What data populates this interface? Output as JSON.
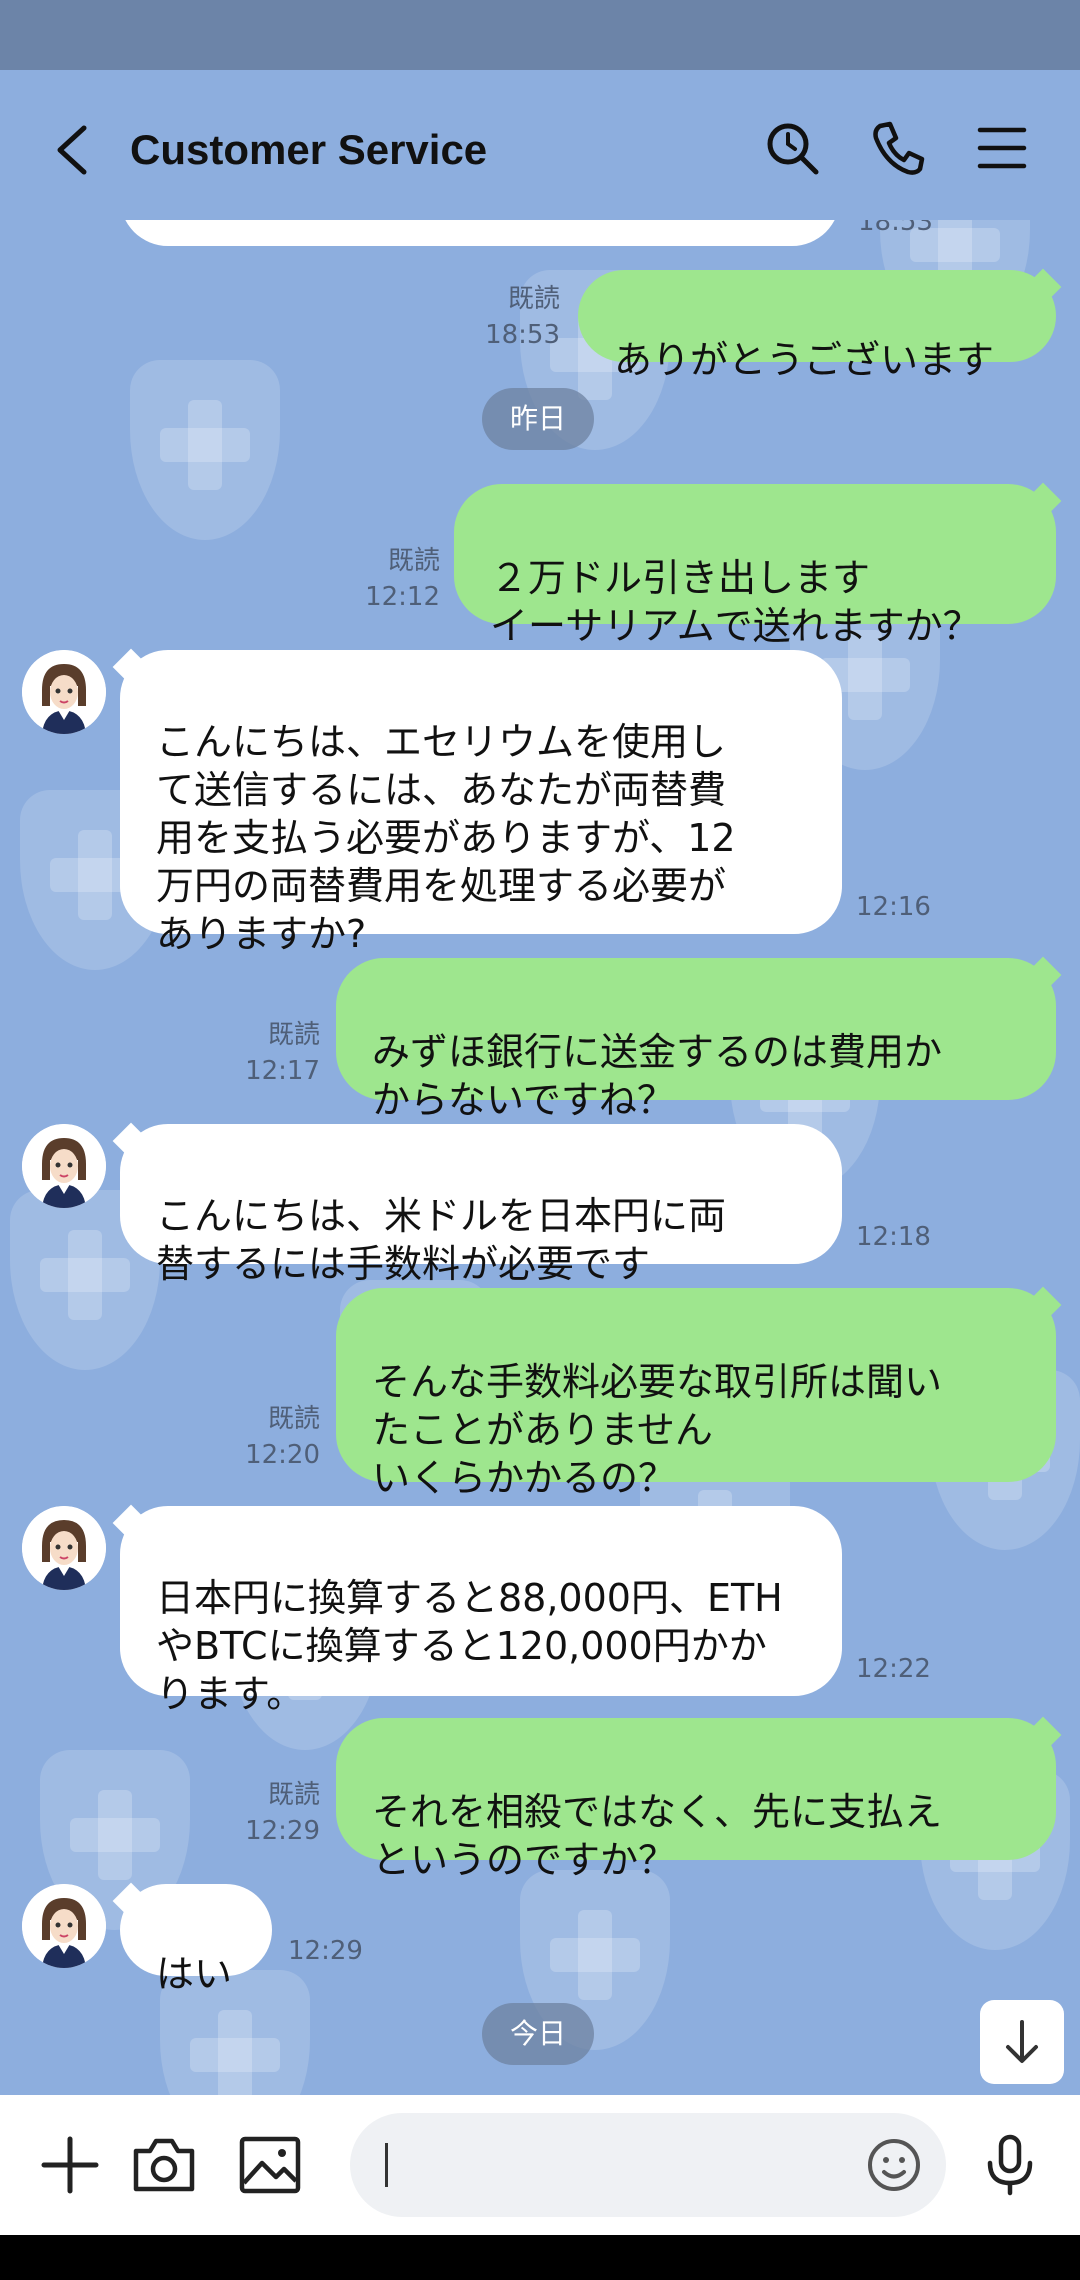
{
  "header": {
    "title": "Customer Service"
  },
  "messages": [
    {
      "side": "out",
      "text": "ありがとうございます",
      "read": "既読",
      "time": "18:53"
    },
    {
      "side": "date",
      "text": "昨日"
    },
    {
      "side": "out",
      "text": "２万ドル引き出します\nイーサリアムで送れますか？",
      "read": "既読",
      "time": "12:12"
    },
    {
      "side": "in",
      "text": "こんにちは、エセリウムを使用し\nて送信するには、あなたが両替費\n用を支払う必要がありますが、12\n万円の両替費用を処理する必要が\nありますか?",
      "time": "12:16"
    },
    {
      "side": "out",
      "text": "みずほ銀行に送金するのは費用か\nからないですね？",
      "read": "既読",
      "time": "12:17"
    },
    {
      "side": "in",
      "text": "こんにちは、米ドルを日本円に両\n替するには手数料が必要です",
      "time": "12:18"
    },
    {
      "side": "out",
      "text": "そんな手数料必要な取引所は聞い\nたことがありません\nいくらかかるの？",
      "read": "既読",
      "time": "12:20"
    },
    {
      "side": "in",
      "text": "日本円に換算すると88,000円、ETH\nやBTCに換算すると120,000円かか\nります。",
      "time": "12:22"
    },
    {
      "side": "out",
      "text": "それを相殺ではなく、先に支払え\nというのですか？",
      "read": "既読",
      "time": "12:29"
    },
    {
      "side": "in",
      "text": "はい",
      "time": "12:29"
    },
    {
      "side": "date",
      "text": "今日"
    }
  ],
  "partial_top": {
    "time": "18:53"
  },
  "input": {
    "placeholder": "",
    "value": ""
  },
  "icons": {
    "back": "chevron-left-icon",
    "search": "search-icon",
    "call": "phone-icon",
    "menu": "hamburger-menu-icon",
    "plus": "plus-icon",
    "camera": "camera-icon",
    "image": "image-icon",
    "emoji": "emoji-icon",
    "mic": "microphone-icon",
    "scroll": "arrow-down-icon"
  },
  "colors": {
    "background": "#8DAEDE",
    "outgoing_bubble": "#9EE68E",
    "incoming_bubble": "#FFFFFF",
    "date_pill": "#6E82A0"
  }
}
